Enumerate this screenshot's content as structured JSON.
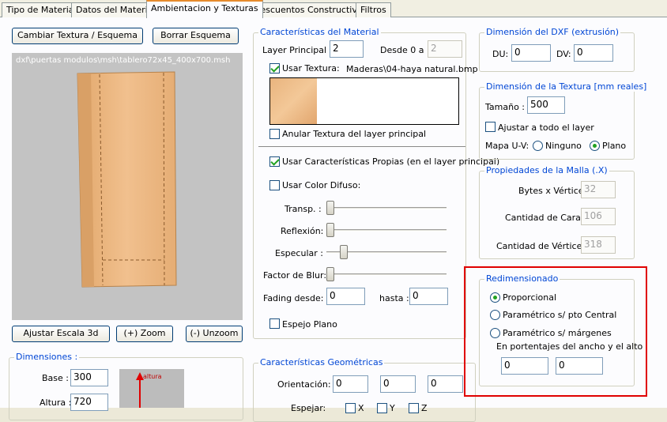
{
  "tabs": [
    {
      "label": "Tipo de Material"
    },
    {
      "label": "Datos del Material"
    },
    {
      "label": "Ambientacion y Texturas"
    },
    {
      "label": "Descuentos Constructivos"
    },
    {
      "label": "Filtros"
    }
  ],
  "left": {
    "cambiar_textura": "Cambiar Textura / Esquema",
    "borrar_esquema": "Borrar Esquema",
    "preview_path": "dxf\\puertas modulos\\msh\\tablero72x45_400x700.msh",
    "ajustar_escala": "Ajustar Escala 3d",
    "zoom_in": "(+) Zoom",
    "zoom_out": "(-) Unzoom",
    "dimensiones": {
      "title": "Dimensiones :",
      "base_label": "Base :",
      "base_value": "300",
      "altura_label": "Altura :",
      "altura_value": "720",
      "axis_label": "altura"
    }
  },
  "material": {
    "title": "Características del Material",
    "layer_label": "Layer Principal :",
    "layer_value": "2",
    "desde_label": "Desde 0 a",
    "desde_value": "2",
    "usar_textura_label": "Usar Textura:",
    "usar_textura_checked": true,
    "texture_file": "Maderas\\04-haya natural.bmp",
    "anular_label": "Anular Textura del layer principal",
    "usar_propias_label": "Usar Características Propias (en el layer principal)",
    "usar_propias_checked": true,
    "usar_color_label": "Usar Color Difuso:",
    "transp_label": "Transp. :",
    "reflexion_label": "Reflexión:",
    "especular_label": "Especular :",
    "blur_label": "Factor de Blur:",
    "fading_label": "Fading desde:",
    "fading_value": "0",
    "hasta_label": "hasta :",
    "hasta_value": "0",
    "espejo_label": "Espejo Plano",
    "slider_levels": {
      "transp": 0,
      "reflexion": 0,
      "especular": 0.12,
      "blur": 0
    }
  },
  "geometricas": {
    "title": "Características Geométricas",
    "orientacion_label": "Orientación:",
    "orientacion_values": [
      "0",
      "0",
      "0"
    ],
    "espejar_label": "Espejar:",
    "x_label": "X",
    "y_label": "Y",
    "z_label": "Z"
  },
  "dxf": {
    "title": "Dimensión del DXF (extrusión)",
    "du_label": "DU:",
    "du_value": "0",
    "dv_label": "DV:",
    "dv_value": "0"
  },
  "textura": {
    "title": "Dimensión de la Textura [mm reales]",
    "tamano_label": "Tamaño :",
    "tamano_value": "500",
    "ajustar_label": "Ajustar a todo el layer",
    "mapa_label": "Mapa U-V:",
    "ninguno_label": "Ninguno",
    "plano_label": "Plano",
    "mapa_selected": "Plano"
  },
  "malla": {
    "title": "Propiedades de la Malla (.X)",
    "bytes_label": "Bytes x Vértice:",
    "bytes_value": "32",
    "caras_label": "Cantidad de Caras:",
    "caras_value": "106",
    "vertices_label": "Cantidad de Vértices:",
    "vertices_value": "318"
  },
  "redim": {
    "title": "Redimensionado",
    "proporcional_label": "Proporcional",
    "pto_central_label": "Paramétrico s/ pto Central",
    "margenes_label": "Paramétrico s/ márgenes",
    "porcentajes_label": "En portentajes del ancho y el alto",
    "ancho_value": "0",
    "alto_value": "0",
    "selected": "Proporcional"
  },
  "colors": {
    "highlight": "#e00000",
    "group_title": "#0046d5",
    "wood": "#e9b47e"
  }
}
